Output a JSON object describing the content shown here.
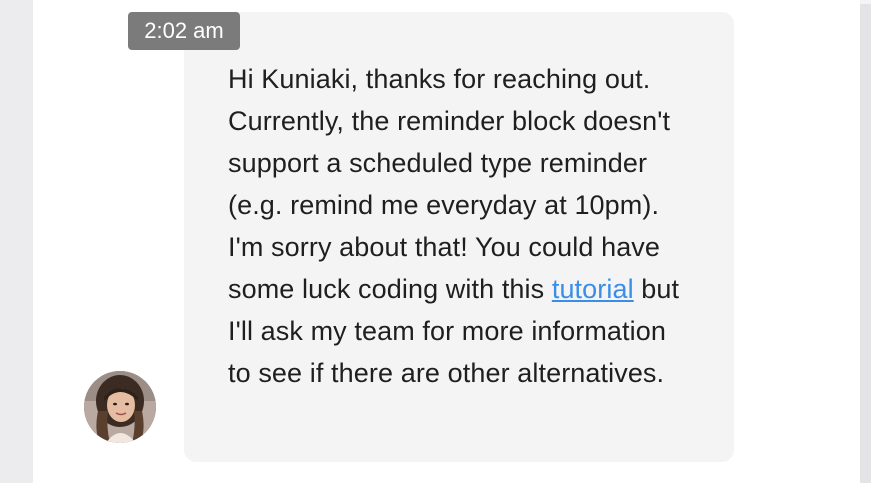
{
  "message": {
    "timestamp": "2:02 am",
    "text_before_link": "Hi Kuniaki, thanks for reaching out. Currently, the reminder block doesn't support a scheduled type reminder (e.g. remind me everyday at 10pm). I'm sorry about that! You could have some luck coding with this ",
    "link_text": "tutorial",
    "text_after_link": " but I'll ask my team for more information to see if there are other alternatives."
  },
  "colors": {
    "bubble_background": "#f4f4f4",
    "timestamp_background": "#7b7b7b",
    "link": "#3a8ee8"
  }
}
